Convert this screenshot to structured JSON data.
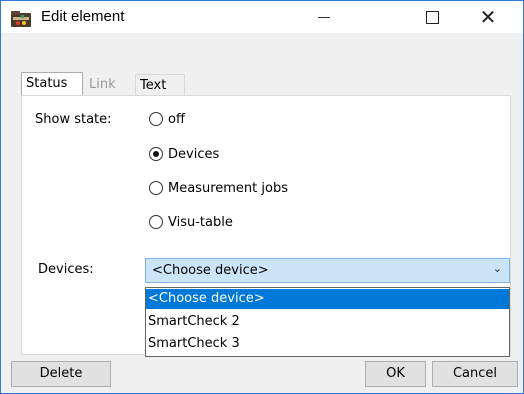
{
  "window": {
    "title": "Edit element",
    "minimize_glyph": "—",
    "maximize_glyph": "☐",
    "close_glyph": "✕"
  },
  "tabs": [
    {
      "label": "Status",
      "state": "active"
    },
    {
      "label": "Link",
      "state": "disabled"
    },
    {
      "label": "Text",
      "state": "normal"
    }
  ],
  "status": {
    "show_state_label": "Show state:",
    "radios": [
      {
        "label": "off",
        "checked": false
      },
      {
        "label": "Devices",
        "checked": true
      },
      {
        "label": "Measurement jobs",
        "checked": false
      },
      {
        "label": "Visu-table",
        "checked": false
      }
    ],
    "devices_label": "Devices:",
    "devices_select": {
      "value": "<Choose device>",
      "arrow": "⌄"
    },
    "devices_options": [
      {
        "label": "<Choose device>",
        "selected": true
      },
      {
        "label": "SmartCheck 2",
        "selected": false
      },
      {
        "label": "SmartCheck 3",
        "selected": false
      }
    ]
  },
  "buttons": {
    "delete": "Delete",
    "ok": "OK",
    "cancel": "Cancel"
  },
  "colors": {
    "window_border": "#2f7ad8",
    "select_bg": "#cce4f7",
    "highlight": "#0078d7"
  },
  "icons": {
    "app": "media-folder-icon"
  }
}
